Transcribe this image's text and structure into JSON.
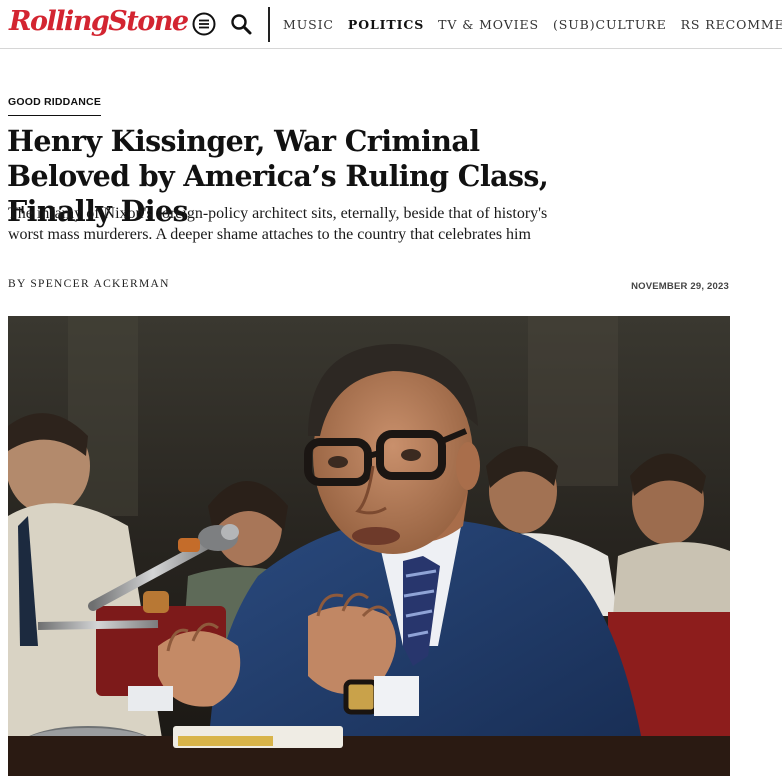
{
  "header": {
    "logo_text": "RollingStone",
    "menu_icon": "hamburger-menu-icon",
    "search_icon": "search-icon",
    "nav": [
      {
        "label": "MUSIC",
        "active": false
      },
      {
        "label": "POLITICS",
        "active": true
      },
      {
        "label": "TV & MOVIES",
        "active": false
      },
      {
        "label": "(SUB)CULTURE",
        "active": false
      },
      {
        "label": "RS RECOMMENDS",
        "active": false
      }
    ]
  },
  "article": {
    "kicker": "GOOD RIDDANCE",
    "headline": "Henry Kissinger, War Criminal Beloved by America’s Ruling Class, Finally Dies",
    "dek": "The infamy of Nixon's foreign-policy architect sits, eternally, beside that of history's worst mass murderers. A deeper shame attaches to the country that celebrates him",
    "byline_prefix": "BY",
    "author": "SPENCER ACKERMAN",
    "date": "NOVEMBER 29, 2023"
  },
  "colors": {
    "brand_red": "#d32531",
    "text": "#111111",
    "divider": "#d6d6d6"
  }
}
